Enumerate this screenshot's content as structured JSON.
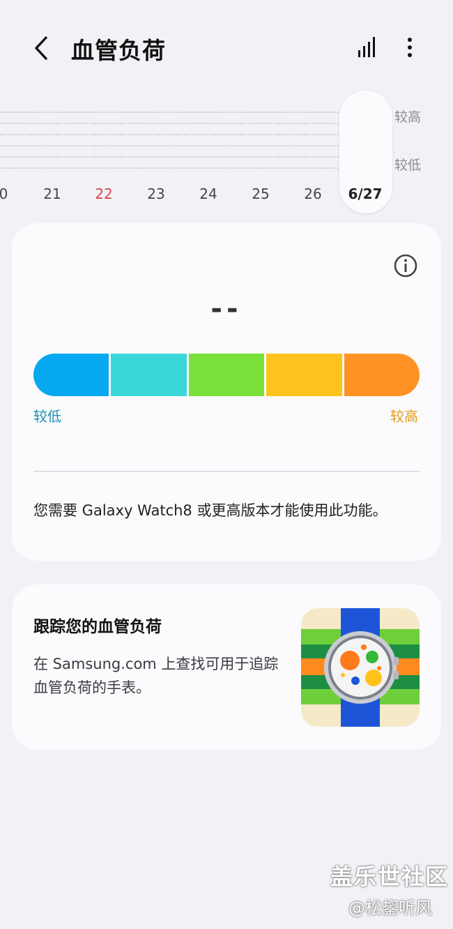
{
  "header": {
    "title": "血管负荷",
    "back_icon": "chevron-left-icon",
    "chart_icon": "bar-chart-icon",
    "more_icon": "more-vertical-icon"
  },
  "trend": {
    "high_label": "较高",
    "low_label": "较低",
    "dates": [
      "0",
      "21",
      "22",
      "23",
      "24",
      "25",
      "26",
      "6/27"
    ],
    "highlight_date": "22",
    "selected_date": "6/27"
  },
  "load_card": {
    "info_icon": "info-icon",
    "value": "--",
    "scale_colors": [
      "#06a8f0",
      "#3ad7d9",
      "#7ae13a",
      "#fdc21c",
      "#ff9224"
    ],
    "low_label": "较低",
    "high_label": "较高",
    "note": "您需要 Galaxy Watch8 或更高版本才能使用此功能。"
  },
  "promo_card": {
    "title": "跟踪您的血管负荷",
    "line1": "在 Samsung.com 上查找可用于追踪",
    "line2": "血管负荷的手表。",
    "image": "galaxy-watch-image"
  },
  "watermark": {
    "line1": "盖乐世社区",
    "line2": "@松鋆听风"
  }
}
